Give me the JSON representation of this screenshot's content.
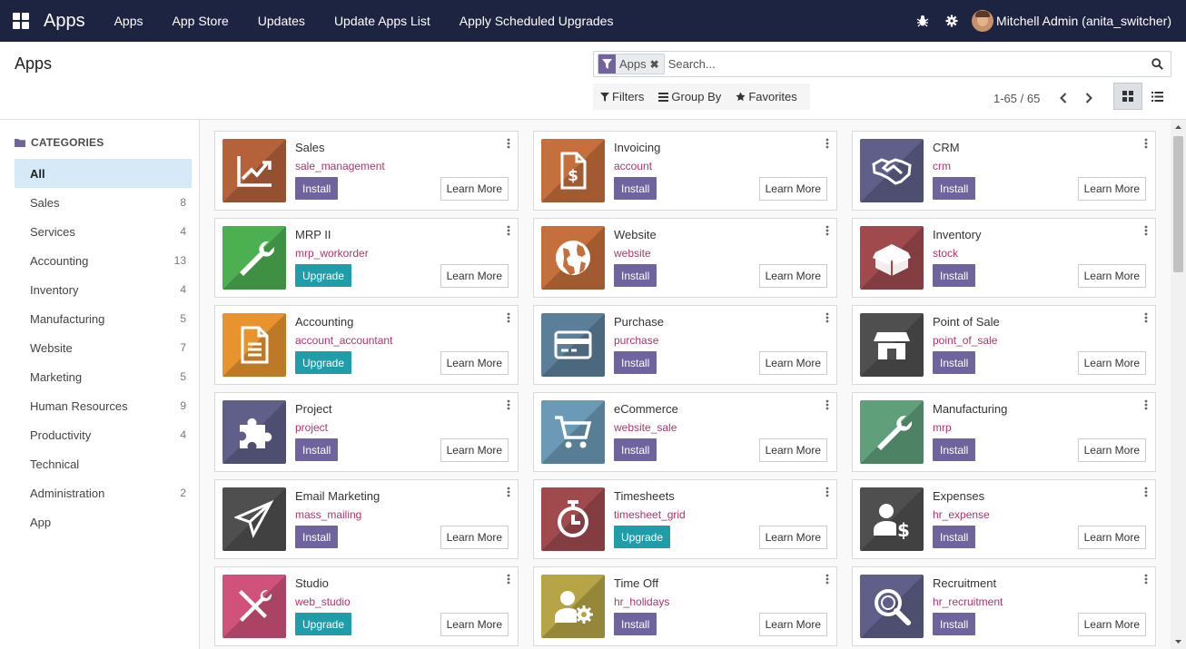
{
  "navbar": {
    "brand": "Apps",
    "menu": [
      "Apps",
      "App Store",
      "Updates",
      "Update Apps List",
      "Apply Scheduled Upgrades"
    ],
    "user": "Mitchell Admin (anita_switcher)",
    "bg_color": "#1d2442"
  },
  "control_panel": {
    "title": "Apps",
    "facet": "Apps",
    "search_placeholder": "Search...",
    "filters_label": "Filters",
    "groupby_label": "Group By",
    "favorites_label": "Favorites",
    "pager": "1-65 / 65"
  },
  "sidebar": {
    "header": "CATEGORIES",
    "items": [
      {
        "label": "All",
        "count": "",
        "active": true
      },
      {
        "label": "Sales",
        "count": "8"
      },
      {
        "label": "Services",
        "count": "4"
      },
      {
        "label": "Accounting",
        "count": "13"
      },
      {
        "label": "Inventory",
        "count": "4"
      },
      {
        "label": "Manufacturing",
        "count": "5"
      },
      {
        "label": "Website",
        "count": "7"
      },
      {
        "label": "Marketing",
        "count": "5"
      },
      {
        "label": "Human Resources",
        "count": "9"
      },
      {
        "label": "Productivity",
        "count": "4"
      },
      {
        "label": "Technical",
        "count": ""
      },
      {
        "label": "Administration",
        "count": "2"
      },
      {
        "label": "App",
        "count": ""
      }
    ]
  },
  "learn_more_label": "Learn More",
  "apps": [
    {
      "name": "Sales",
      "tech": "sale_management",
      "action": "Install",
      "icon": "trend-chart-icon",
      "color": "#b5623b"
    },
    {
      "name": "Invoicing",
      "tech": "account",
      "action": "Install",
      "icon": "invoice-dollar-icon",
      "color": "#c56f3c"
    },
    {
      "name": "CRM",
      "tech": "crm",
      "action": "Install",
      "icon": "handshake-icon",
      "color": "#5f5f8a"
    },
    {
      "name": "MRP II",
      "tech": "mrp_workorder",
      "action": "Upgrade",
      "icon": "wrench-icon",
      "color": "#4caf50"
    },
    {
      "name": "Website",
      "tech": "website",
      "action": "Install",
      "icon": "globe-icon",
      "color": "#c56f3c"
    },
    {
      "name": "Inventory",
      "tech": "stock",
      "action": "Install",
      "icon": "box-icon",
      "color": "#a04a4e"
    },
    {
      "name": "Accounting",
      "tech": "account_accountant",
      "action": "Upgrade",
      "icon": "document-icon",
      "color": "#e8942e"
    },
    {
      "name": "Purchase",
      "tech": "purchase",
      "action": "Install",
      "icon": "credit-card-icon",
      "color": "#5c7f99"
    },
    {
      "name": "Point of Sale",
      "tech": "point_of_sale",
      "action": "Install",
      "icon": "store-icon",
      "color": "#4f4f4f"
    },
    {
      "name": "Project",
      "tech": "project",
      "action": "Install",
      "icon": "puzzle-icon",
      "color": "#5f5f8a"
    },
    {
      "name": "eCommerce",
      "tech": "website_sale",
      "action": "Install",
      "icon": "shopping-cart-icon",
      "color": "#6a9ab5"
    },
    {
      "name": "Manufacturing",
      "tech": "mrp",
      "action": "Install",
      "icon": "wrench-icon",
      "color": "#5f9f7a"
    },
    {
      "name": "Email Marketing",
      "tech": "mass_mailing",
      "action": "Install",
      "icon": "paper-plane-icon",
      "color": "#4f4f4f"
    },
    {
      "name": "Timesheets",
      "tech": "timesheet_grid",
      "action": "Upgrade",
      "icon": "stopwatch-icon",
      "color": "#a04a4e"
    },
    {
      "name": "Expenses",
      "tech": "hr_expense",
      "action": "Install",
      "icon": "user-dollar-icon",
      "color": "#4f4f4f"
    },
    {
      "name": "Studio",
      "tech": "web_studio",
      "action": "Upgrade",
      "icon": "tools-icon",
      "color": "#d0527a"
    },
    {
      "name": "Time Off",
      "tech": "hr_holidays",
      "action": "Install",
      "icon": "user-gear-icon",
      "color": "#b5a547"
    },
    {
      "name": "Recruitment",
      "tech": "hr_recruitment",
      "action": "Install",
      "icon": "magnifier-icon",
      "color": "#5f5f8a"
    }
  ]
}
